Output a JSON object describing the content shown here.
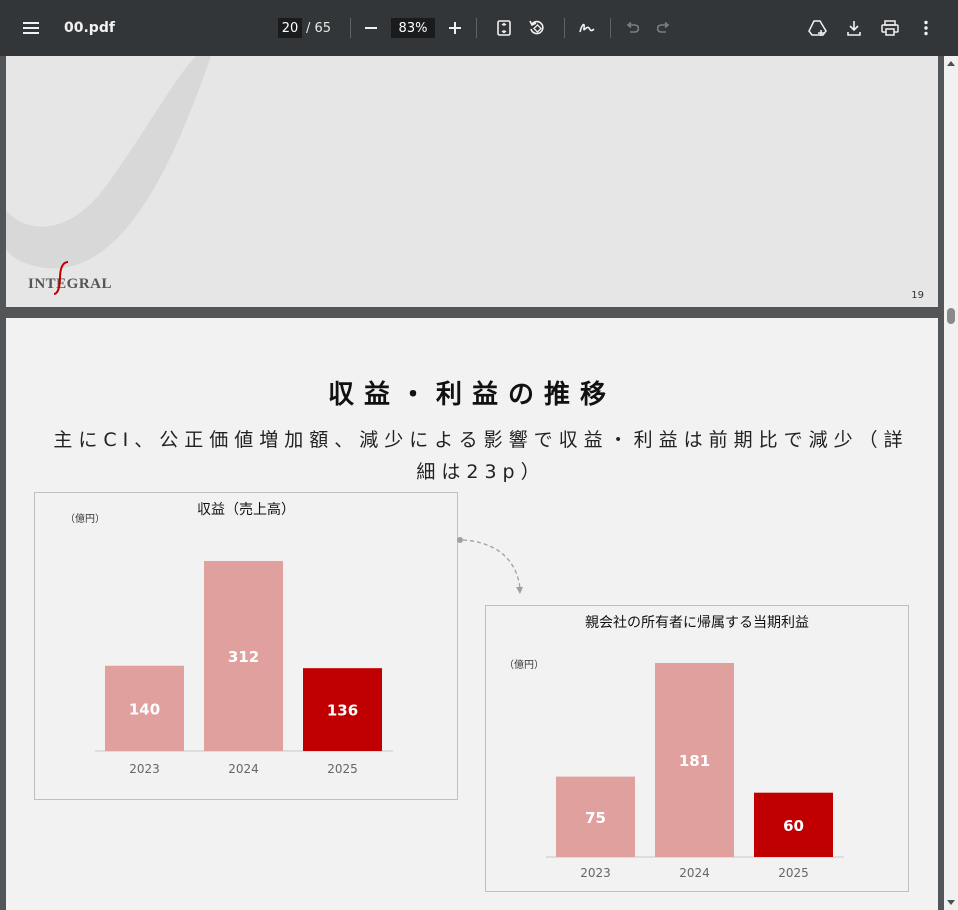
{
  "toolbar": {
    "filename": "00.pdf",
    "page_current": "20",
    "page_total": "/ 65",
    "zoom": "83%"
  },
  "prev_page": {
    "logo_text": "INTEGRAL",
    "page_number": "19"
  },
  "slide": {
    "title": "収益・利益の推移",
    "subtitle": "主にCI、公正価値増加額、減少による影響で収益・利益は前期比で減少（詳細は23p）"
  },
  "chart_data": [
    {
      "type": "bar",
      "title": "収益（売上高）",
      "unit": "（億円）",
      "categories": [
        "2023",
        "2024",
        "2025"
      ],
      "values": [
        140,
        312,
        136
      ],
      "colors": [
        "#e0a09e",
        "#e0a09e",
        "#c00000"
      ],
      "ylim": [
        0,
        312
      ]
    },
    {
      "type": "bar",
      "title": "親会社の所有者に帰属する当期利益",
      "unit": "（億円）",
      "categories": [
        "2023",
        "2024",
        "2025"
      ],
      "values": [
        75,
        181,
        60
      ],
      "colors": [
        "#e0a09e",
        "#e0a09e",
        "#c00000"
      ],
      "ylim": [
        0,
        181
      ]
    }
  ]
}
